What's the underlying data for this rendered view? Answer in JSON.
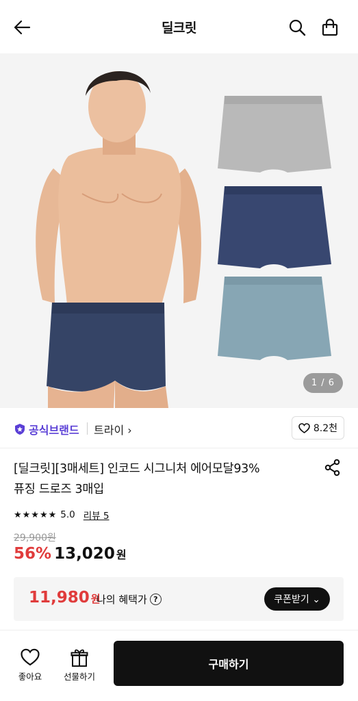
{
  "header": {
    "title": "딜크릿",
    "back_icon": "arrow-left-icon",
    "search_icon": "search-icon",
    "cart_icon": "shopping-bag-icon"
  },
  "gallery": {
    "counter": "1 / 6",
    "image_description_icons": [
      "product-model-photo",
      "briefs-grey",
      "briefs-navy",
      "briefs-blue"
    ]
  },
  "brand": {
    "official_label": "공식브랜드",
    "brand_link": "트라이 ›",
    "likes": "8.2천"
  },
  "product": {
    "title_line1": "[딜크릿][3매세트] 인코드 시그니처 에어모달93%",
    "title_line2": "퓨징 드로즈 3매입",
    "stars": "★★★★★",
    "rating": "5.0",
    "reviews": "리뷰 5",
    "original_price": "29,900원",
    "discount": "56%",
    "price": "13,020",
    "currency": "원"
  },
  "benefit": {
    "price": "11,980",
    "currency": "원",
    "label": "나의 혜택가",
    "help": "?",
    "coupon_button": "쿠폰받기 ⌄"
  },
  "bottom": {
    "like_label": "좋아요",
    "gift_label": "선물하기",
    "buy_label": "구매하기"
  },
  "colors": {
    "accent_red": "#e03c3c",
    "brand_purple": "#5a3fd6",
    "dark": "#111111"
  }
}
